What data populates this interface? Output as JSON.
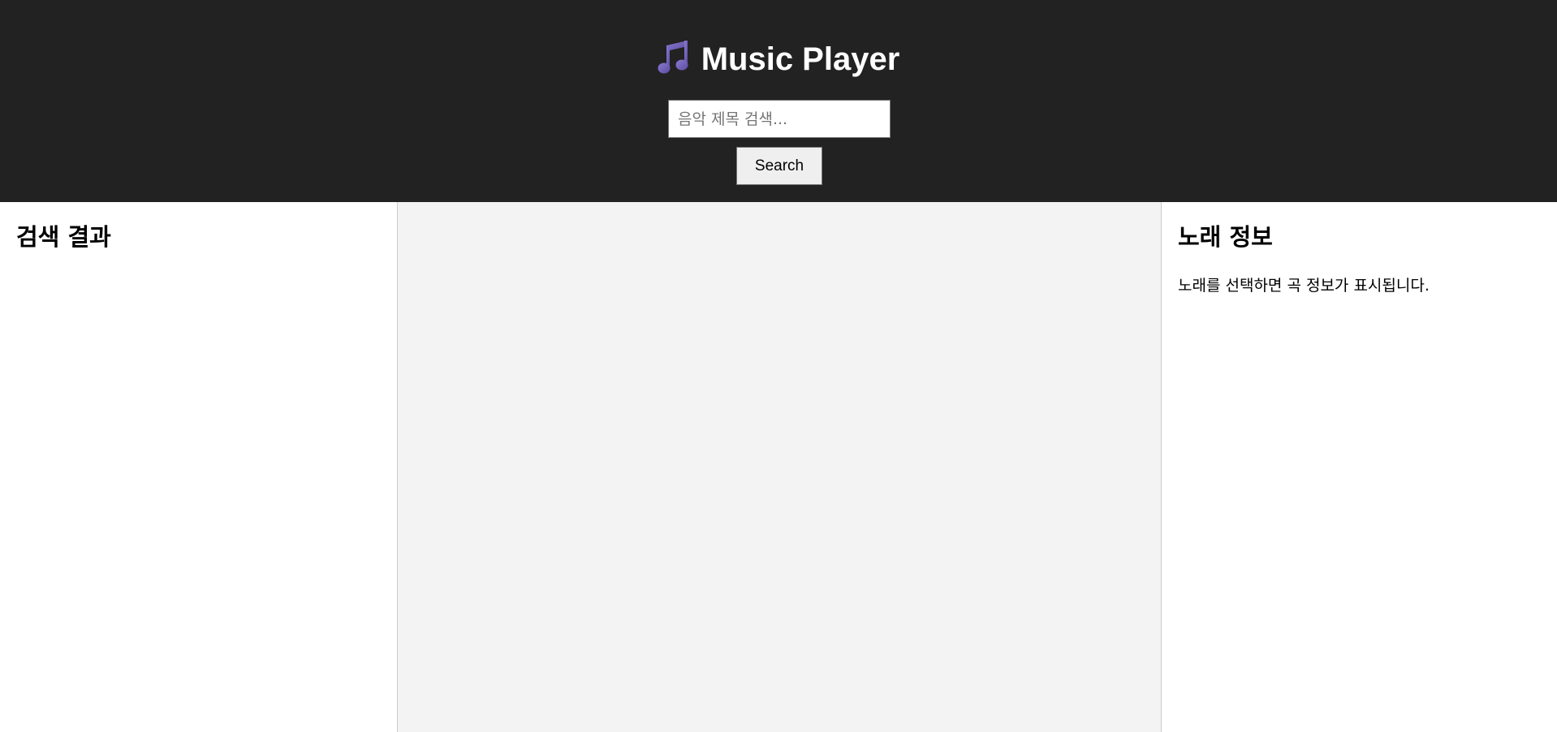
{
  "header": {
    "title": "Music Player",
    "title_icon": "music-note-icon",
    "icon_color": "#6f5fb3",
    "background": "#222222"
  },
  "search": {
    "placeholder": "음악 제목 검색...",
    "value": "",
    "button_label": "Search"
  },
  "results_panel": {
    "heading": "검색 결과",
    "items": []
  },
  "player_panel": {
    "background": "#f3f3f3"
  },
  "info_panel": {
    "heading": "노래 정보",
    "message": "노래를 선택하면 곡 정보가 표시됩니다."
  }
}
